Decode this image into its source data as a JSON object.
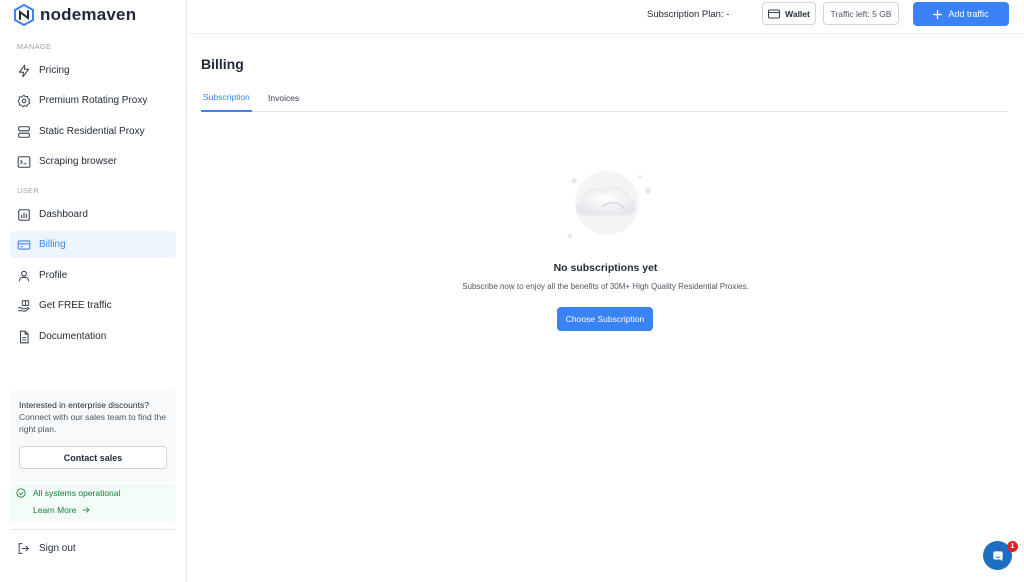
{
  "brand": {
    "name_prefix": "node",
    "name_suffix": "maven",
    "color": "#3b82f6"
  },
  "sidebar": {
    "sections": [
      {
        "label": "MANAGE"
      },
      {
        "label": "USER"
      }
    ],
    "manage_items": [
      {
        "label": "Pricing",
        "icon": "bolt-icon"
      },
      {
        "label": "Premium Rotating Proxy",
        "icon": "gear-icon"
      },
      {
        "label": "Static Residential Proxy",
        "icon": "server-icon"
      },
      {
        "label": "Scraping browser",
        "icon": "terminal-icon"
      }
    ],
    "user_items": [
      {
        "label": "Dashboard",
        "icon": "bar-chart-icon"
      },
      {
        "label": "Billing",
        "icon": "credit-card-icon",
        "active": true
      },
      {
        "label": "Profile",
        "icon": "user-icon"
      },
      {
        "label": "Get FREE traffic",
        "icon": "gift-hand-icon"
      },
      {
        "label": "Documentation",
        "icon": "document-icon"
      }
    ],
    "promo": {
      "title": "Interested in enterprise discounts?",
      "text": "Connect with our sales team to find the right plan.",
      "button_label": "Contact sales"
    },
    "status": {
      "text": "All systems operational",
      "link_label": "Learn More",
      "color": "#15803d"
    },
    "signout_label": "Sign out"
  },
  "topbar": {
    "subscription_plan": "Subscription Plan: -",
    "wallet_label": "Wallet",
    "traffic_left": "Traffic left: 5 GB",
    "add_traffic_label": "Add traffic"
  },
  "main": {
    "title": "Billing",
    "tabs": [
      {
        "label": "Subscription",
        "active": true
      },
      {
        "label": "Invoices",
        "active": false
      }
    ],
    "empty_state": {
      "icon": "cloud-icon",
      "title": "No subscriptions yet",
      "subtitle": "Subscribe now to enjoy all the benefits of 30M+ High Quality Residential Proxies.",
      "button_label": "Choose Subscription"
    }
  },
  "chat": {
    "badge_count": "1"
  }
}
